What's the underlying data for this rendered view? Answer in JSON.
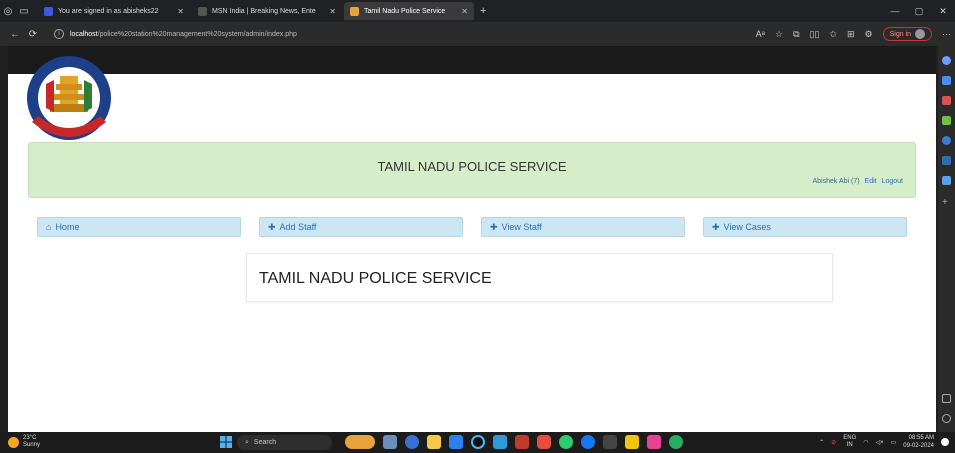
{
  "browser": {
    "tabs": [
      {
        "label": "You are signed in as abisheks22",
        "favicon_color": "#3b5bdb",
        "active": false
      },
      {
        "label": "MSN India | Breaking News, Ente",
        "favicon_color": "#555555",
        "active": false
      },
      {
        "label": "Tamil Nadu Police Service",
        "favicon_color": "#e8a33d",
        "active": true
      }
    ],
    "new_tab": "+",
    "url_host": "localhost",
    "url_path": "/police%20station%20management%20system/admin/index.php",
    "sign_in": "Sign in"
  },
  "page": {
    "logo_text": "TAMILNADU POLICE",
    "logo_motto": "SERVICE · TO · NATION",
    "banner_title": "TAMIL NADU POLICE SERVICE",
    "user_text": "Abishek Abi (7)",
    "edit_link": "Edit",
    "logout_link": "Logout",
    "nav": [
      {
        "label": "Home",
        "icon": "home-icon"
      },
      {
        "label": "Add Staff",
        "icon": "plus-icon"
      },
      {
        "label": "View Staff",
        "icon": "plus-icon"
      },
      {
        "label": "View Cases",
        "icon": "plus-icon"
      }
    ],
    "card_title": "TAMIL NADU POLICE SERVICE"
  },
  "taskbar": {
    "temp": "23°C",
    "weather": "Sunny",
    "search": "Search",
    "lang": "ENG",
    "region": "IN",
    "time": "08:55 AM",
    "date": "09-02-2024"
  },
  "colors": {
    "banner_bg": "#d6edc9",
    "nav_bg": "#cde6f4",
    "link": "#2a6fb0"
  }
}
